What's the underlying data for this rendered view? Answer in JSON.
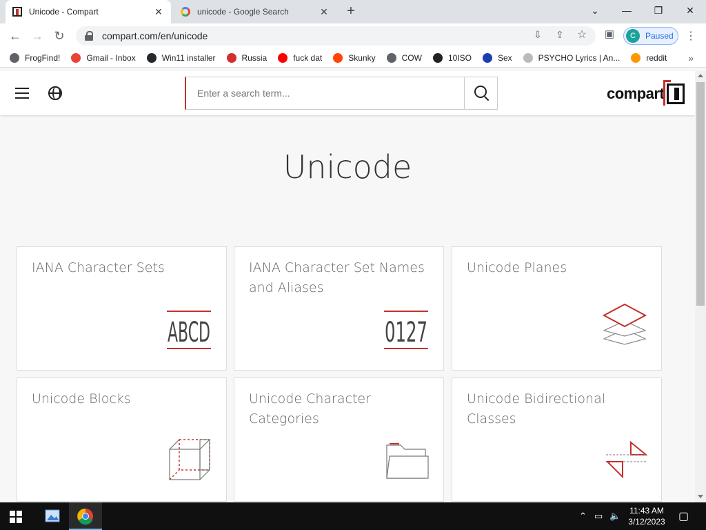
{
  "browser": {
    "tabs": [
      {
        "title": "Unicode - Compart",
        "active": true
      },
      {
        "title": "unicode - Google Search",
        "active": false
      }
    ],
    "new_tab": "+",
    "window_controls": {
      "minimize": "—",
      "maximize": "❐",
      "close": "✕"
    },
    "url": "compart.com/en/unicode",
    "profile": {
      "initial": "C",
      "label": "Paused"
    },
    "bookmarks": [
      {
        "label": "FrogFind!",
        "icon": "globe-icon",
        "color": "#5f6368"
      },
      {
        "label": "Gmail - Inbox",
        "icon": "gmail-icon",
        "color": "#ea4335"
      },
      {
        "label": "Win11 installer",
        "icon": "github-icon",
        "color": "#24292e"
      },
      {
        "label": "Russia",
        "icon": "russia-site-icon",
        "color": "#d32f2f"
      },
      {
        "label": "fuck dat",
        "icon": "youtube-icon",
        "color": "#ff0000"
      },
      {
        "label": "Skunky",
        "icon": "reddit-icon",
        "color": "#ff4500"
      },
      {
        "label": "COW",
        "icon": "globe-icon",
        "color": "#5f6368"
      },
      {
        "label": "10ISO",
        "icon": "building-icon",
        "color": "#222222"
      },
      {
        "label": "Sex",
        "icon": "s-icon",
        "color": "#1a3fb5"
      },
      {
        "label": "PSYCHO Lyrics | An...",
        "icon": "loading-icon",
        "color": "#bbbbbb"
      },
      {
        "label": "reddit",
        "icon": "rainbow-icon",
        "color": "#ff9800"
      }
    ],
    "bookmarks_more": "»"
  },
  "site": {
    "search_placeholder": "Enter a search term...",
    "logo_text": "compart",
    "page_title": "Unicode",
    "cards": [
      {
        "title": "IANA Character Sets",
        "icon": "abcd-icon",
        "icon_text": "ABCD"
      },
      {
        "title": "IANA Character Set Names and Aliases",
        "icon": "0127-icon",
        "icon_text": "0127"
      },
      {
        "title": "Unicode Planes",
        "icon": "layers-icon"
      },
      {
        "title": "Unicode Blocks",
        "icon": "cube-icon"
      },
      {
        "title": "Unicode Character Categories",
        "icon": "folder-icon"
      },
      {
        "title": "Unicode Bidirectional Classes",
        "icon": "bidi-arrows-icon"
      }
    ],
    "accent_color": "#c4302b"
  },
  "taskbar": {
    "time": "11:43 AM",
    "date": "3/12/2023"
  }
}
